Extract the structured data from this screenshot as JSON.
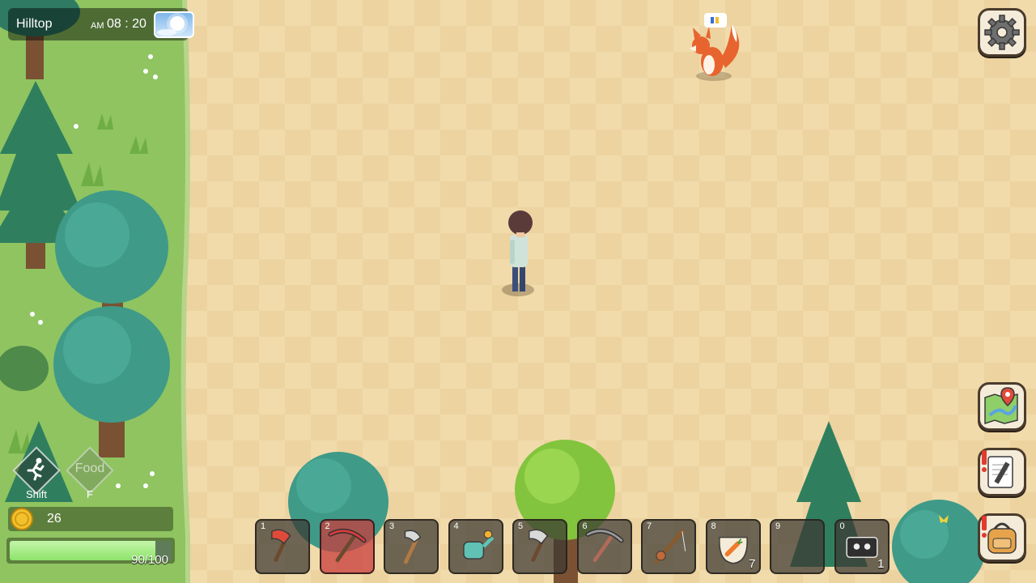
{
  "hud": {
    "location": "Hilltop",
    "time_ampm": "AM",
    "time": "08 : 20",
    "weather_icon": "sunny-icon"
  },
  "actions": {
    "sprint_key": "Shift",
    "food_label": "Food",
    "food_key": "F"
  },
  "coins": {
    "value": "26"
  },
  "health": {
    "text": "90/100",
    "current": 90,
    "max": 100
  },
  "hotbar": {
    "selected_slot": 2,
    "slots": [
      {
        "num": "1",
        "item_icon": "red-axe-icon",
        "count": ""
      },
      {
        "num": "2",
        "item_icon": "pickaxe-icon",
        "count": ""
      },
      {
        "num": "3",
        "item_icon": "hatchet-icon",
        "count": ""
      },
      {
        "num": "4",
        "item_icon": "watering-can-icon",
        "count": ""
      },
      {
        "num": "5",
        "item_icon": "steel-axe-icon",
        "count": ""
      },
      {
        "num": "6",
        "item_icon": "steel-pickaxe-icon",
        "count": ""
      },
      {
        "num": "7",
        "item_icon": "fishing-rod-icon",
        "count": ""
      },
      {
        "num": "8",
        "item_icon": "carrot-seed-bag-icon",
        "count": "7"
      },
      {
        "num": "9",
        "item_icon": "",
        "count": ""
      },
      {
        "num": "0",
        "item_icon": "cassette-icon",
        "count": "1"
      }
    ]
  },
  "buttons": {
    "settings_icon": "gear-icon",
    "map_icon": "map-icon",
    "journal_icon": "journal-icon",
    "bag_icon": "backpack-icon"
  },
  "colors": {
    "ground": "#f0d9a9",
    "grass": "#8fc460",
    "hp_fill": "#8ee46b",
    "selected_slot": "#c83c3c"
  }
}
